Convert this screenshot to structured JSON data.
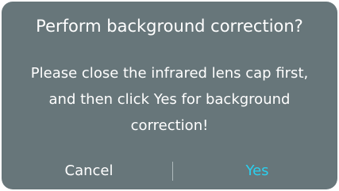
{
  "dialog": {
    "title": "Perform background correction?",
    "message_lines": [
      "Please close the infrared lens cap first,",
      "and then click Yes for background",
      "correction!"
    ],
    "cancel_label": "Cancel",
    "yes_label": "Yes"
  },
  "colors": {
    "dialog_background": "#67767a",
    "text": "#ffffff",
    "accent": "#2ad0ef"
  }
}
